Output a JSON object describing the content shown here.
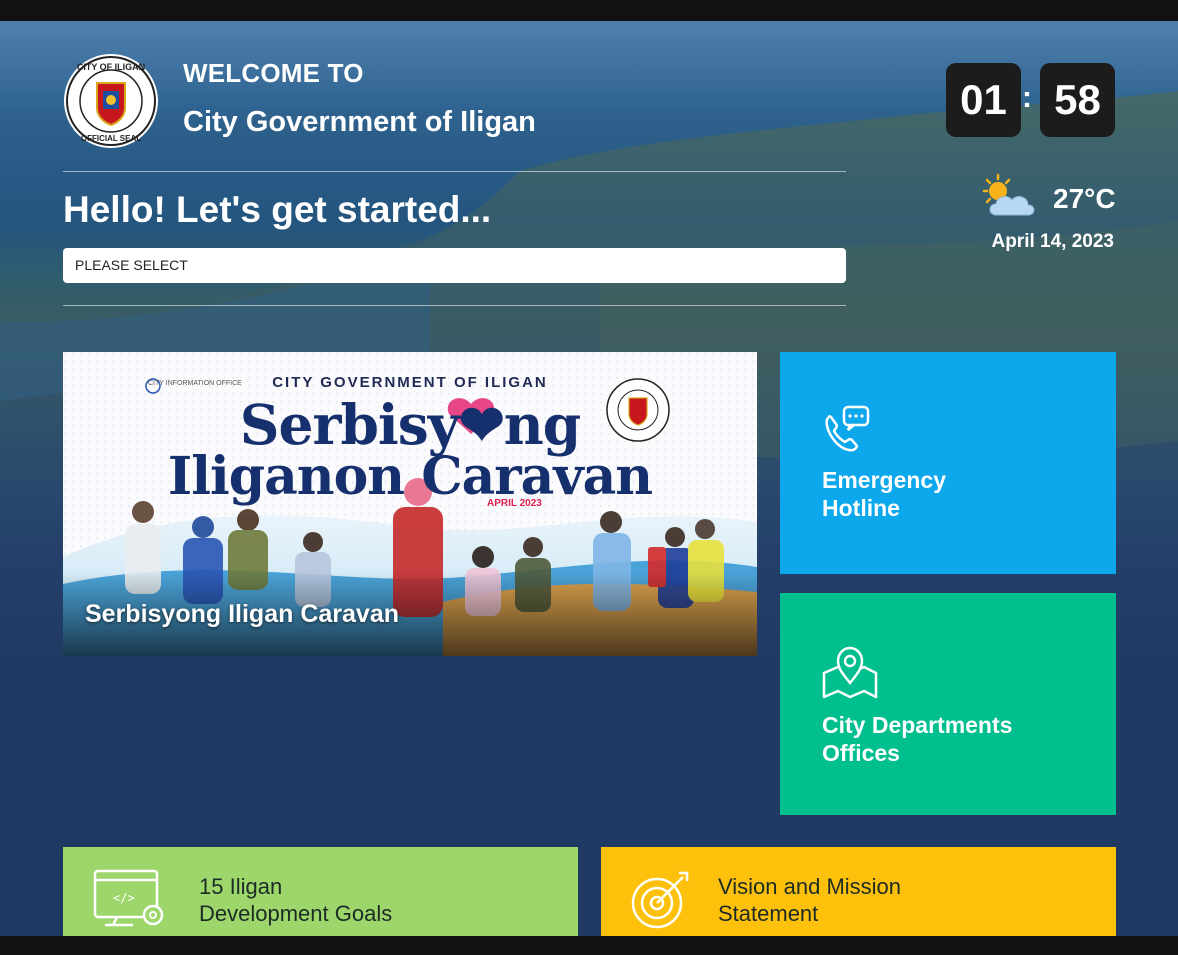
{
  "header": {
    "welcome": "WELCOME TO",
    "city_name": "City Government of Iligan",
    "seal_text_top": "CITY OF ILIGAN",
    "seal_text_bottom": "OFFICIAL SEAL"
  },
  "greeting": "Hello! Let's get started...",
  "select": {
    "value": "PLEASE SELECT"
  },
  "clock": {
    "hours": "01",
    "separator": ":",
    "minutes": "58"
  },
  "weather": {
    "icon": "partly-cloudy-icon",
    "temperature": "27°C",
    "date": "April 14, 2023"
  },
  "banner": {
    "subtitle": "CITY GOVERNMENT OF ILIGAN",
    "title_line1": "Serbisy❤ng",
    "title_line2": "Iliganon Caravan",
    "month": "APRIL 2023",
    "office": "CITY INFORMATION OFFICE",
    "caption": "Serbisyong Iligan Caravan"
  },
  "tiles": {
    "emergency": {
      "label_line1": "Emergency",
      "label_line2": "Hotline",
      "icon": "phone-chat-icon",
      "color": "#0da7ec"
    },
    "departments": {
      "label_line1": "City Departments",
      "label_line2": "Offices",
      "icon": "map-pin-icon",
      "color": "#00bf8f"
    },
    "goals": {
      "label_line1": "15 Iligan",
      "label_line2": "Development Goals",
      "icon": "computer-settings-icon",
      "color": "#9dd66b"
    },
    "vision": {
      "label_line1": "Vision and Mission",
      "label_line2": "Statement",
      "icon": "target-icon",
      "color": "#fdc10b"
    }
  }
}
